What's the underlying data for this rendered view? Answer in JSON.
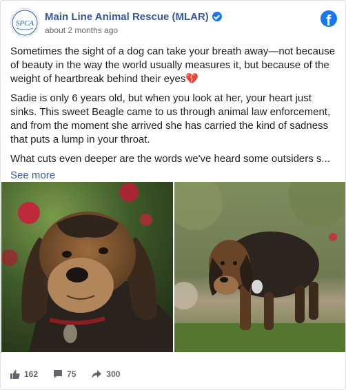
{
  "header": {
    "page_name": "Main Line Animal Rescue (MLAR)",
    "timestamp": "about 2 months ago",
    "avatar_text": "SPCA",
    "avatar_caption": "MAIN LINE ANIMAL RESCUE"
  },
  "post": {
    "paragraphs": [
      "Sometimes the sight of a dog can take your breath away—not because of beauty in the way the world usually measures it, but because of the weight of heartbreak behind their eyes💔",
      "Sadie is only 6 years old, but when you look at her, your heart just sinks. This sweet Beagle came to us through animal law enforcement, and from the moment she arrived she has carried the kind of sadness that puts a lump in your throat.",
      "What cuts even deeper are the words we've heard some outsiders s..."
    ],
    "see_more": "See more"
  },
  "photos": [
    {
      "alt": "Close-up of a senior Beagle with red flowers behind"
    },
    {
      "alt": "Beagle walking on grass"
    }
  ],
  "footer": {
    "likes": "162",
    "comments": "75",
    "shares": "300"
  },
  "colors": {
    "link": "#385898",
    "brand": "#1877f2",
    "meta": "#606770"
  }
}
